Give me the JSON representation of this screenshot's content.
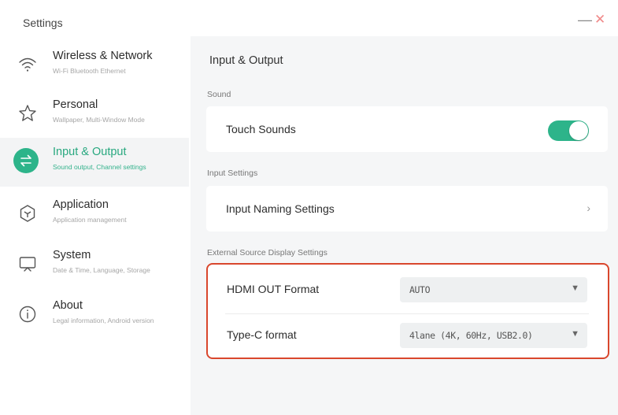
{
  "window": {
    "title": "Settings",
    "minimize": "—",
    "close": "✕"
  },
  "sidebar": {
    "items": [
      {
        "title": "Wireless & Network",
        "subtitle": "Wi-Fi Bluetooth Ethernet",
        "icon": "wifi-icon"
      },
      {
        "title": "Personal",
        "subtitle": "Wallpaper, Multi-Window Mode",
        "icon": "star-icon"
      },
      {
        "title": "Input & Output",
        "subtitle": "Sound output, Channel settings",
        "icon": "swap-arrows-icon",
        "active": true
      },
      {
        "title": "Application",
        "subtitle": "Application management",
        "icon": "hexagon-icon"
      },
      {
        "title": "System",
        "subtitle": "Date & Time, Language, Storage",
        "icon": "monitor-icon"
      },
      {
        "title": "About",
        "subtitle": "Legal information, Android version",
        "icon": "info-icon"
      }
    ]
  },
  "main": {
    "title": "Input & Output",
    "sound": {
      "label": "Sound",
      "touch_sounds": "Touch Sounds",
      "touch_sounds_on": true
    },
    "input": {
      "label": "Input Settings",
      "naming": "Input Naming Settings",
      "chevron": "›"
    },
    "external": {
      "label": "External Source Display Settings",
      "hdmi_label": "HDMI OUT Format",
      "hdmi_value": "AUTO",
      "typec_label": "Type-C format",
      "typec_value": "4lane (4K, 60Hz, USB2.0)",
      "arrow": "▼"
    }
  },
  "colors": {
    "accent": "#2db48a",
    "highlight_border": "#d9472d",
    "close": "#f08a8a"
  }
}
